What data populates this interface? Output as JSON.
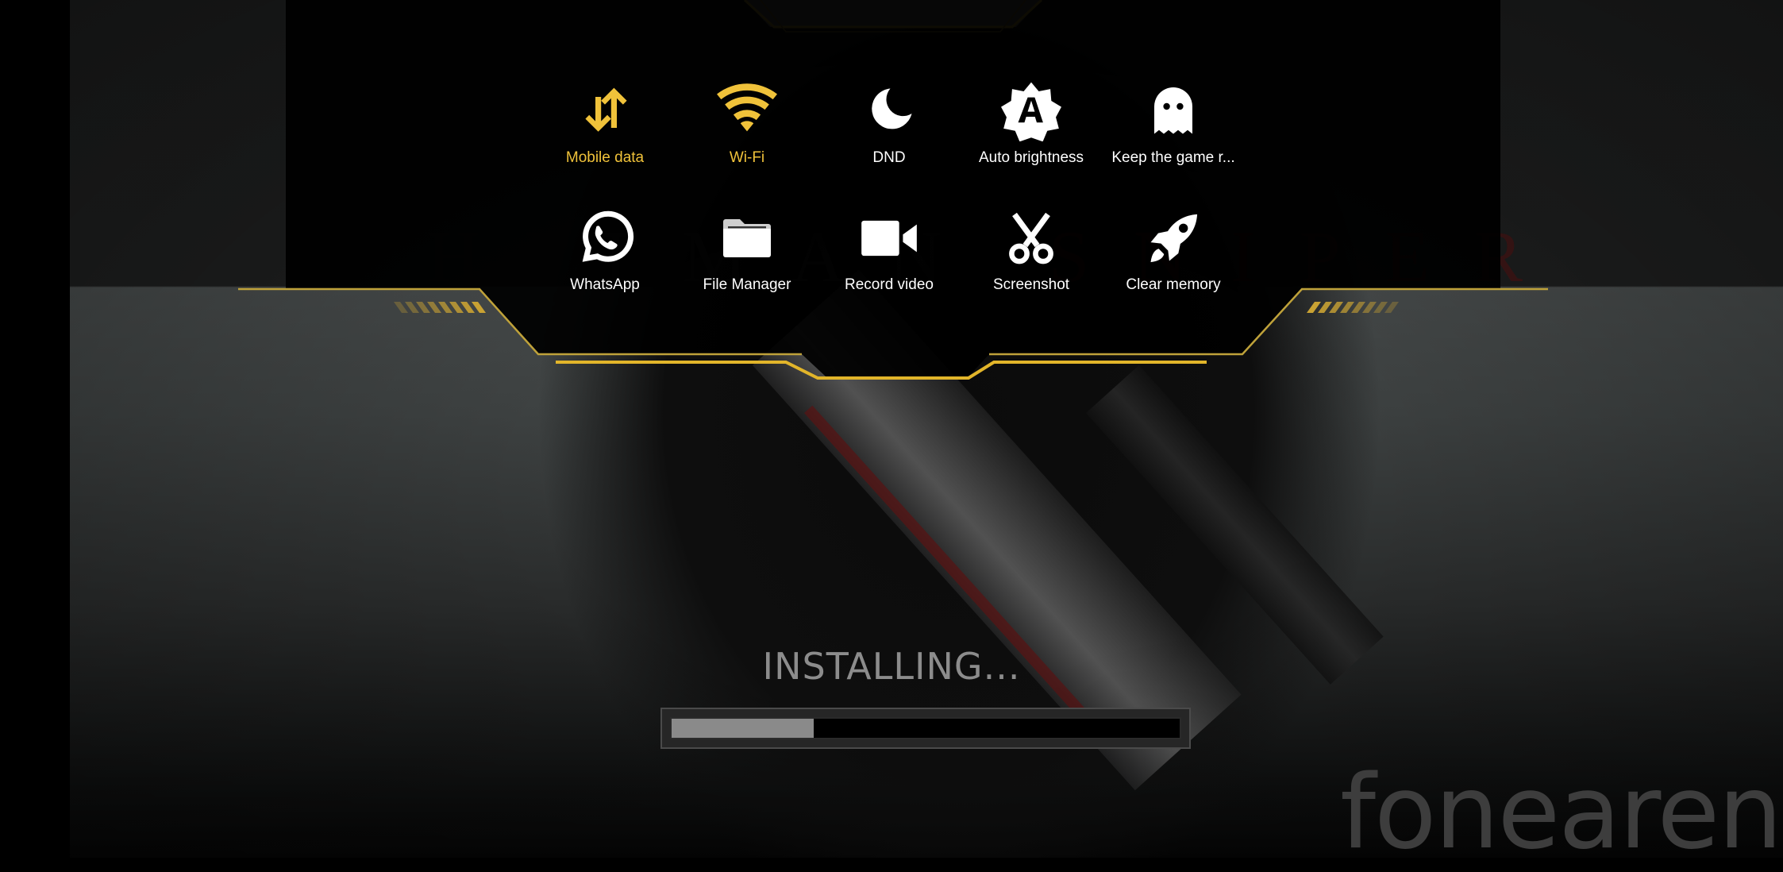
{
  "game": {
    "title_left": "HITMAN",
    "title_right": "SNIPER",
    "status_text": "INSTALLING...",
    "progress_percent": 28
  },
  "quick_panel": {
    "accent_color": "#f0c23a",
    "inactive_color": "#ffffff",
    "tiles": [
      {
        "label": "Mobile data",
        "icon": "mobile-data-icon",
        "active": true
      },
      {
        "label": "Wi-Fi",
        "icon": "wifi-icon",
        "active": true
      },
      {
        "label": "DND",
        "icon": "moon-icon",
        "active": false
      },
      {
        "label": "Auto brightness",
        "icon": "auto-brightness-icon",
        "active": false
      },
      {
        "label": "Keep the game r...",
        "icon": "ghost-icon",
        "active": false
      },
      {
        "label": "WhatsApp",
        "icon": "whatsapp-icon",
        "active": false
      },
      {
        "label": "File Manager",
        "icon": "folder-icon",
        "active": false
      },
      {
        "label": "Record video",
        "icon": "video-camera-icon",
        "active": false
      },
      {
        "label": "Screenshot",
        "icon": "scissors-icon",
        "active": false
      },
      {
        "label": "Clear memory",
        "icon": "rocket-icon",
        "active": false
      }
    ]
  },
  "watermark": "fonearena"
}
